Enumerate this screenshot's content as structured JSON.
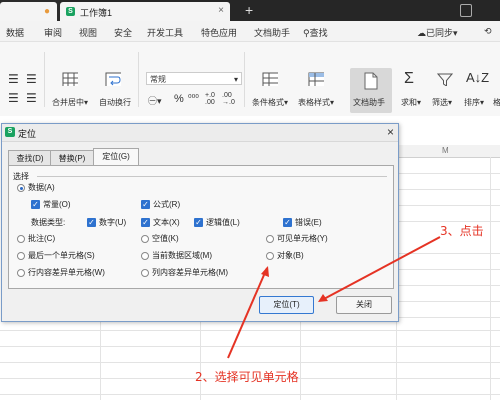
{
  "tabs": {
    "sheet_tab": "工作簿1"
  },
  "menu": [
    "数据",
    "审阅",
    "视图",
    "安全",
    "开发工具",
    "特色应用",
    "文档助手",
    "查找"
  ],
  "sync": "已同步",
  "ribbon": {
    "merge": "合并居中",
    "wrap": "自动换行",
    "number_format": "常规",
    "cond_format": "条件格式",
    "table_style": "表格样式",
    "doc_assist": "文档助手",
    "sum": "求和",
    "filter": "筛选",
    "sort": "排序",
    "fill": "格"
  },
  "sheet": {
    "col_label": "M"
  },
  "dialog": {
    "title": "定位",
    "tabs": [
      "查找(D)",
      "替换(P)",
      "定位(G)"
    ],
    "group_label": "选择",
    "options": {
      "data": "数据(A)",
      "constants": "常量(O)",
      "formulas": "公式(R)",
      "data_type": "数据类型:",
      "number": "数字(U)",
      "text": "文本(X)",
      "logical": "逻辑值(L)",
      "error": "错误(E)",
      "comment": "批注(C)",
      "blank": "空值(K)",
      "visible": "可见单元格(Y)",
      "last_cell": "最后一个单元格(S)",
      "current_region": "当前数据区域(M)",
      "object": "对象(B)",
      "row_diff": "行内容差异单元格(W)",
      "col_diff": "列内容差异单元格(M)"
    },
    "buttons": {
      "locate": "定位(T)",
      "close": "关闭"
    }
  },
  "annotations": {
    "step3": "3、点击",
    "step2": "2、选择可见单元格"
  },
  "colors": {
    "accent": "#2e72cf",
    "annotation": "#e53324",
    "brand_green": "#1aa260"
  }
}
